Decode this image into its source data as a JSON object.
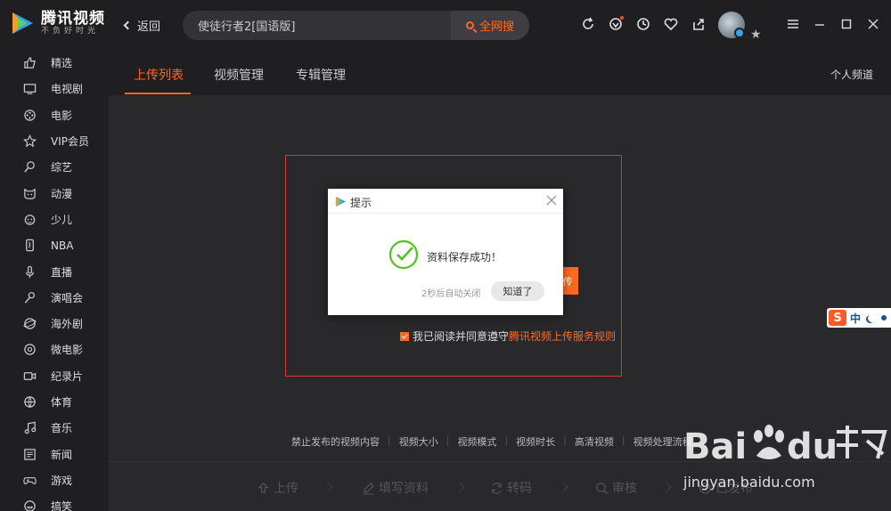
{
  "app": {
    "name": "腾讯视频",
    "slogan": "不负好时光"
  },
  "header": {
    "back_label": "返回",
    "search_value": "使徒行者2[国语版]",
    "search_button": "全网搜"
  },
  "sidebar": {
    "items": [
      {
        "label": "精选",
        "icon": "thumb-up-icon"
      },
      {
        "label": "电视剧",
        "icon": "tv-icon"
      },
      {
        "label": "电影",
        "icon": "film-reel-icon"
      },
      {
        "label": "VIP会员",
        "icon": "vip-star-icon"
      },
      {
        "label": "综艺",
        "icon": "variety-icon"
      },
      {
        "label": "动漫",
        "icon": "cat-face-icon"
      },
      {
        "label": "少儿",
        "icon": "child-face-icon"
      },
      {
        "label": "NBA",
        "icon": "nba-icon"
      },
      {
        "label": "直播",
        "icon": "microphone-icon"
      },
      {
        "label": "演唱会",
        "icon": "concert-mic-icon"
      },
      {
        "label": "海外剧",
        "icon": "globe-icon"
      },
      {
        "label": "微电影",
        "icon": "micro-film-icon"
      },
      {
        "label": "纪录片",
        "icon": "camera-icon"
      },
      {
        "label": "体育",
        "icon": "ball-icon"
      },
      {
        "label": "音乐",
        "icon": "music-note-icon"
      },
      {
        "label": "新闻",
        "icon": "news-icon"
      },
      {
        "label": "游戏",
        "icon": "gamepad-icon"
      },
      {
        "label": "搞笑",
        "icon": "laugh-icon"
      }
    ]
  },
  "tabs": {
    "items": [
      "上传列表",
      "视频管理",
      "专辑管理"
    ],
    "active": "上传列表",
    "personal_channel": "个人频道"
  },
  "upload": {
    "button_char": "传",
    "agree_text": "我已阅读并同意遵守",
    "agree_link": "腾讯视频上传服务规则"
  },
  "bottom_links": [
    "禁止发布的视频内容",
    "视频大小",
    "视频模式",
    "视频时长",
    "高清视频",
    "视频处理流程"
  ],
  "steps": [
    "上传",
    "填写资料",
    "转码",
    "审核",
    "已发布"
  ],
  "dialog": {
    "title": "提示",
    "message": "资料保存成功！",
    "auto_close": "2秒后自动关闭",
    "ok_button": "知道了"
  },
  "ime": {
    "logo": "S",
    "mode": "中"
  },
  "watermark": {
    "url": "jingyan.baidu.com"
  },
  "colors": {
    "accent": "#ff6a1f",
    "border_red": "#d23c2a",
    "success_green": "#52c41a"
  }
}
